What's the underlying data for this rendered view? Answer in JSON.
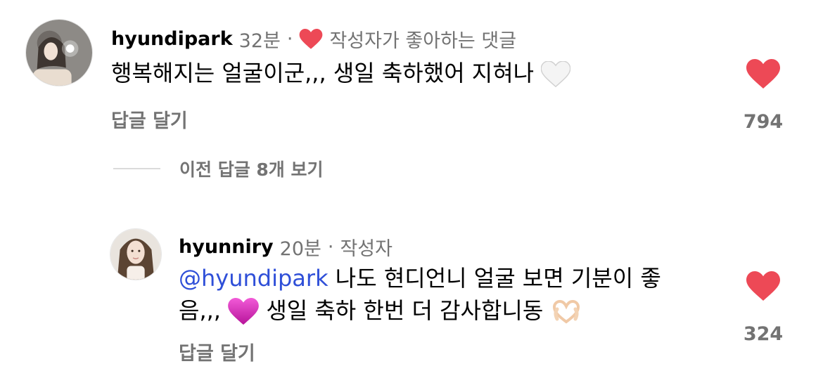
{
  "comments": [
    {
      "username": "hyundipark",
      "time": "32분",
      "separator": "·",
      "liked_by_author": "작성자가 좋아하는 댓글",
      "text": "행복해지는 얼굴이군,,, 생일 축하했어 지혀나",
      "reply_label": "답글 달기",
      "like_count": "794",
      "like_color": "#ed4956"
    },
    {
      "username": "hyunniry",
      "time": "20분",
      "separator": "·",
      "author_badge": "작성자",
      "mention": "@hyundipark",
      "text_line1": " 나도 현디언니 얼굴 보면 기분이 좋",
      "text_line2_a": "음,,,",
      "text_line2_b": "생일 축하 한번 더 감사합니동",
      "reply_label": "답글 달기",
      "like_count": "324",
      "like_color": "#ed4956"
    }
  ],
  "view_previous_replies": "이전 답글 8개 보기"
}
